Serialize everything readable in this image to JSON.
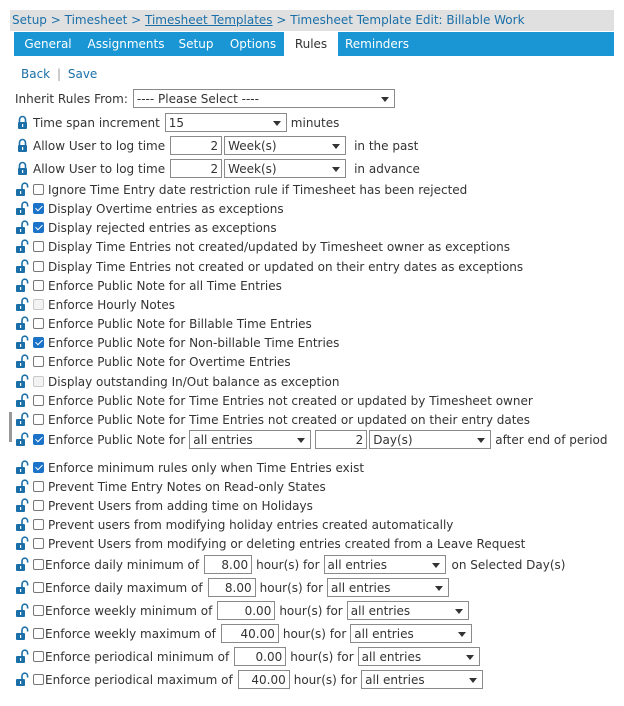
{
  "breadcrumb": {
    "setup": "Setup",
    "sep1": " > ",
    "timesheet": "Timesheet",
    "sep2": " > ",
    "templates": "Timesheet Templates",
    "sep3": " > ",
    "current": "Timesheet Template Edit: Billable Work"
  },
  "tabs": [
    "General",
    "Assignments",
    "Setup",
    "Options",
    "Rules",
    "Reminders"
  ],
  "active_tab": "Rules",
  "actions": {
    "back": "Back",
    "sep": "|",
    "save": "Save"
  },
  "inherit": {
    "label": "Inherit Rules From:",
    "value": "---- Please Select ----"
  },
  "time_span": {
    "label": "Time span increment",
    "value": "15",
    "unit": "minutes"
  },
  "past": {
    "label": "Allow User to log time",
    "value": "2",
    "period": "Week(s)",
    "suffix": "in the past"
  },
  "advance": {
    "label": "Allow User to log time",
    "value": "2",
    "period": "Week(s)",
    "suffix": "in advance"
  },
  "rules": [
    {
      "label": "Ignore Time Entry date restriction rule if Timesheet has been rejected",
      "checked": false,
      "disabled": false
    },
    {
      "label": "Display Overtime entries as exceptions",
      "checked": true,
      "disabled": false
    },
    {
      "label": "Display rejected entries as exceptions",
      "checked": true,
      "disabled": false
    },
    {
      "label": "Display Time Entries not created/updated by Timesheet owner as exceptions",
      "checked": false,
      "disabled": false
    },
    {
      "label": "Display Time Entries not created or updated on their entry dates as exceptions",
      "checked": false,
      "disabled": false
    },
    {
      "label": "Enforce Public Note for all Time Entries",
      "checked": false,
      "disabled": false
    },
    {
      "label": "Enforce Hourly Notes",
      "checked": false,
      "disabled": true
    },
    {
      "label": "Enforce Public Note for Billable Time Entries",
      "checked": false,
      "disabled": false
    },
    {
      "label": "Enforce Public Note for Non-billable Time Entries",
      "checked": true,
      "disabled": false
    },
    {
      "label": "Enforce Public Note for Overtime Entries",
      "checked": false,
      "disabled": false
    },
    {
      "label": "Display outstanding In/Out balance as exception",
      "checked": false,
      "disabled": true
    },
    {
      "label": "Enforce Public Note for Time Entries not created or updated by Timesheet owner",
      "checked": false,
      "disabled": false
    },
    {
      "label": "Enforce Public Note for Time Entries not created or updated on their entry dates",
      "checked": false,
      "disabled": false
    }
  ],
  "public_note_period": {
    "label": "Enforce Public Note for",
    "checked": true,
    "entries": "all entries",
    "value": "2",
    "period": "Day(s)",
    "suffix": "after end of period"
  },
  "rules2": [
    {
      "label": "Enforce minimum rules only when Time Entries exist",
      "checked": true
    },
    {
      "label": "Prevent Time Entry Notes on Read-only States",
      "checked": false
    },
    {
      "label": "Prevent Users from adding time on Holidays",
      "checked": false
    },
    {
      "label": "Prevent users from modifying holiday entries created automatically",
      "checked": false
    },
    {
      "label": "Prevent Users from modifying or deleting entries created from a Leave Request",
      "checked": false
    }
  ],
  "limits": [
    {
      "label": "Enforce daily minimum of",
      "value": "8.00",
      "unit": "hour(s) for",
      "entries": "all entries",
      "suffix": "on Selected Day(s)"
    },
    {
      "label": "Enforce daily maximum of",
      "value": "8.00",
      "unit": "hour(s) for",
      "entries": "all entries",
      "suffix": ""
    },
    {
      "label": "Enforce weekly minimum of",
      "value": "0.00",
      "unit": "hour(s) for",
      "entries": "all entries",
      "suffix": ""
    },
    {
      "label": "Enforce weekly maximum of",
      "value": "40.00",
      "unit": "hour(s) for",
      "entries": "all entries",
      "suffix": ""
    },
    {
      "label": "Enforce periodical minimum of",
      "value": "0.00",
      "unit": "hour(s) for",
      "entries": "all entries",
      "suffix": ""
    },
    {
      "label": "Enforce periodical maximum of",
      "value": "40.00",
      "unit": "hour(s) for",
      "entries": "all entries",
      "suffix": ""
    }
  ],
  "colors": {
    "tab_bar": "#1a96d4",
    "link": "#1a6fa8",
    "lock_closed": "#1a6fa8",
    "checkbox_checked": "#1a73c8"
  }
}
